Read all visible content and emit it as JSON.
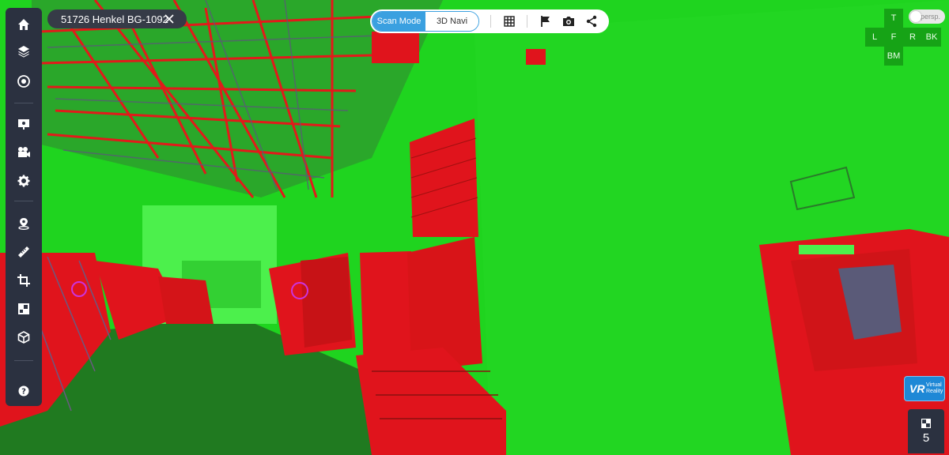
{
  "title": "51726 Henkel BG-1092",
  "toolbar": {
    "scan_mode": "Scan Mode",
    "nav_3d": "3D Navi"
  },
  "left_toolbar": [
    {
      "name": "home-icon"
    },
    {
      "name": "layers-icon"
    },
    {
      "name": "compass-icon"
    },
    {
      "name": "presentation-icon"
    },
    {
      "name": "video-camera-icon"
    },
    {
      "name": "gear-icon"
    },
    {
      "name": "map-pin-icon"
    },
    {
      "name": "ruler-icon"
    },
    {
      "name": "crop-icon"
    },
    {
      "name": "clipping-box-icon"
    },
    {
      "name": "cube-icon"
    },
    {
      "name": "help-icon"
    }
  ],
  "top_icons": [
    "grid-icon",
    "flag-icon",
    "camera-icon",
    "share-icon"
  ],
  "view_cube": {
    "top": "T",
    "left": "L",
    "front": "F",
    "right": "R",
    "back": "BK",
    "bottom": "BM",
    "projection": "persp."
  },
  "vr": {
    "mark": "VR",
    "line1": "Virtual",
    "line2": "Reality"
  },
  "scan_count": "5",
  "colors": {
    "accent": "#3aa0e0",
    "toolbar_bg": "#2b3140",
    "point_cloud_green": "#1fd41f",
    "point_cloud_red": "#e8141c"
  }
}
